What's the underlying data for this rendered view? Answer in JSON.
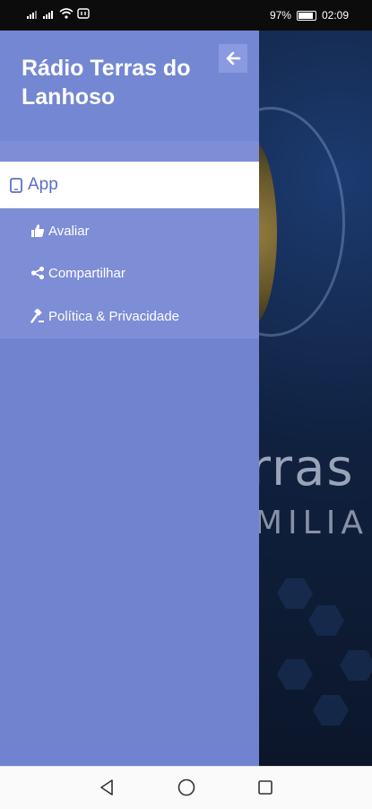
{
  "status_bar": {
    "battery_percent": "97%",
    "time": "02:09"
  },
  "drawer": {
    "title": "Rádio Terras do Lanhoso",
    "back_icon": "arrow-left-icon",
    "menu": {
      "app": {
        "label": "App",
        "icon": "tablet-icon"
      },
      "items": [
        {
          "label": "Avaliar",
          "icon": "thumbs-up-icon"
        },
        {
          "label": "Compartilhar",
          "icon": "share-icon"
        },
        {
          "label": "Política & Privacidade",
          "icon": "gavel-icon"
        }
      ]
    },
    "colors": {
      "drawer_bg": "#7183cf",
      "active_item_bg": "#ffffff",
      "active_item_text": "#5d6fc4"
    }
  },
  "background_app": {
    "text_line_1": "rras",
    "text_line_2": "MILIA"
  },
  "nav_bar": {
    "back_icon": "triangle-back-icon",
    "home_icon": "circle-home-icon",
    "recents_icon": "square-recents-icon"
  }
}
